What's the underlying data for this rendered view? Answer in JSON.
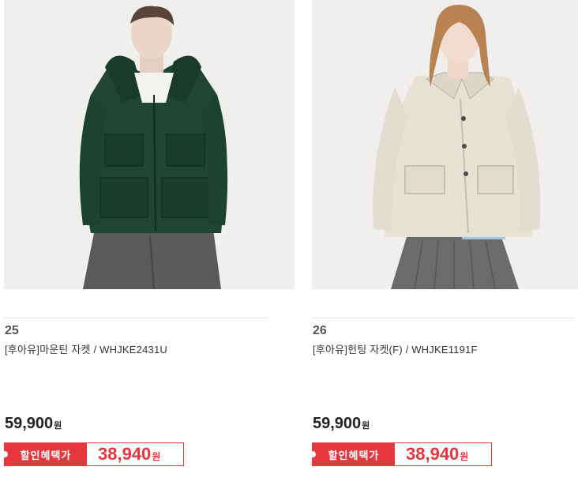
{
  "products": [
    {
      "rank": "25",
      "name": "[후아유]마운틴 자켓 / WHJKE2431U",
      "price": "59,900",
      "price_unit": "원",
      "benefit_label": "할인혜택가",
      "sale_price": "38,940",
      "sale_unit": "원"
    },
    {
      "rank": "26",
      "name": "[후아유]헌팅 자켓(F) / WHJKE1191F",
      "price": "59,900",
      "price_unit": "원",
      "benefit_label": "할인혜택가",
      "sale_price": "38,940",
      "sale_unit": "원"
    }
  ],
  "colors": {
    "accent": "#e6373f",
    "price_text": "#222222",
    "photo_background": "#efeeec"
  }
}
